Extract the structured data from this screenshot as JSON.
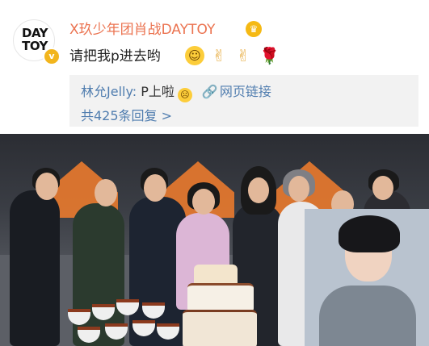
{
  "post": {
    "avatar_line1": "DAY",
    "avatar_line2": "TOY",
    "verified_badge": "v",
    "username": "X玖少年团肖战DAYTOY",
    "crown_icon": "crown-icon",
    "comment_text": "请把我p进去哟",
    "emojis": [
      "smile-emoji",
      "victory-hand-emoji",
      "victory-hand-emoji",
      "rose-emoji"
    ],
    "reply_author": "林允Jelly:",
    "reply_text": "P上啦",
    "reply_emoji": "crying-face-emoji",
    "link_label": "网页链接",
    "more_replies": "共425条回复 >"
  },
  "colors": {
    "username": "#eb7350",
    "link": "#507daf",
    "reply_bg": "#f2f2f2",
    "badge": "#f2b51d"
  }
}
